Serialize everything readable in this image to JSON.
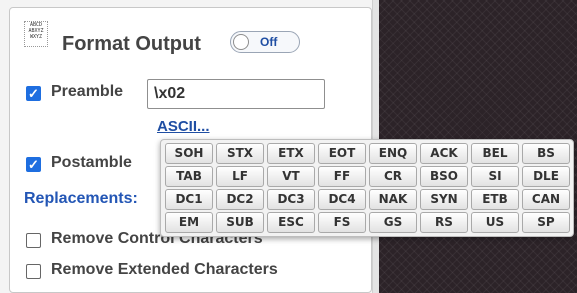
{
  "format": {
    "icon_text": "ABCD\nABXYZ\nWXYZ",
    "title": "Format Output",
    "toggle_label": "Off"
  },
  "preamble": {
    "checked": true,
    "label": "Preamble",
    "value": "\\x02"
  },
  "ascii_link": "ASCII...",
  "postamble": {
    "checked": true,
    "label": "Postamble"
  },
  "replacements_label": "Replacements:",
  "remove_control": {
    "checked": false,
    "label": "Remove Control Characters"
  },
  "remove_extended": {
    "checked": false,
    "label": "Remove Extended Characters"
  },
  "ascii_keys": [
    "SOH",
    "STX",
    "ETX",
    "EOT",
    "ENQ",
    "ACK",
    "BEL",
    "BS",
    "TAB",
    "LF",
    "VT",
    "FF",
    "CR",
    "BSO",
    "SI",
    "DLE",
    "DC1",
    "DC2",
    "DC3",
    "DC4",
    "NAK",
    "SYN",
    "ETB",
    "CAN",
    "EM",
    "SUB",
    "ESC",
    "FS",
    "GS",
    "RS",
    "US",
    "SP"
  ],
  "colors": {
    "accent": "#1e6ee0",
    "link": "#1f4ea3",
    "right_bg": "#2c2328"
  }
}
